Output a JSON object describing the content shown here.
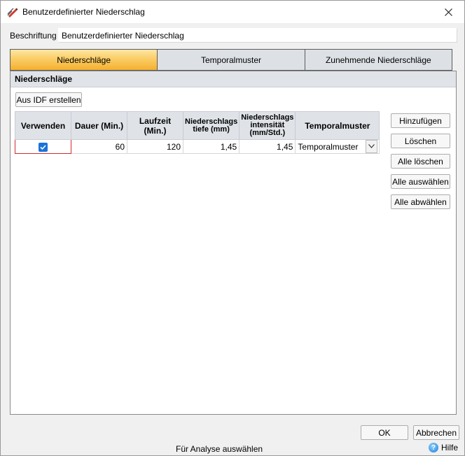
{
  "window": {
    "title": "Benutzerdefinierter Niederschlag",
    "close_icon": "close-icon"
  },
  "description": {
    "label": "Beschriftung",
    "value": "Benutzerdefinierter Niederschlag"
  },
  "tabs": [
    {
      "label": "Niederschläge",
      "active": true
    },
    {
      "label": "Temporalmuster",
      "active": false
    },
    {
      "label": "Zunehmende Niederschläge",
      "active": false
    }
  ],
  "panel": {
    "header": "Niederschläge",
    "idf_button": "Aus IDF erstellen"
  },
  "grid": {
    "columns": [
      "Verwenden",
      "Dauer (Min.)",
      "Laufzeit (Min.)",
      "Niederschlags tiefe (mm)",
      "Niederschlags intensität (mm/Std.)",
      "Temporalmuster"
    ],
    "rows": [
      {
        "use": true,
        "duration": "60",
        "runtime": "120",
        "depth": "1,45",
        "intensity": "1,45",
        "temporal": "Temporalmuster"
      }
    ]
  },
  "side_buttons": {
    "add": "Hinzufügen",
    "delete": "Löschen",
    "delete_all": "Alle löschen",
    "select_all": "Alle auswählen",
    "deselect_all": "Alle abwählen"
  },
  "footer": {
    "ok": "OK",
    "cancel": "Abbrechen",
    "status": "Für Analyse auswählen",
    "help": "Hilfe"
  },
  "colors": {
    "active_tab": "#f5b02f",
    "checkbox": "#1a73d9",
    "error_border": "#d22b2b"
  }
}
